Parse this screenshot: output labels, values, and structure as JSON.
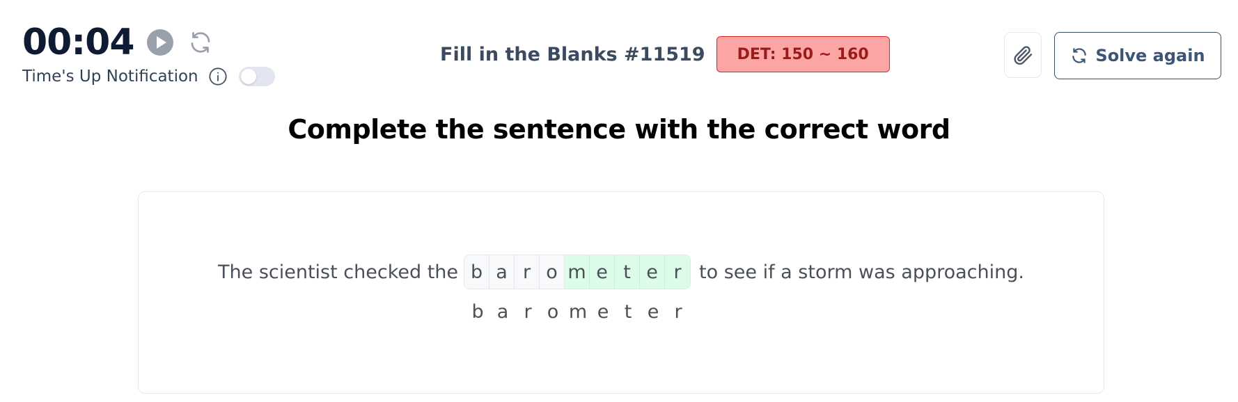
{
  "timer": {
    "time": "00:04",
    "notification_label": "Time's Up Notification",
    "notification_enabled": false
  },
  "header": {
    "quiz_title": "Fill in the Blanks #11519",
    "det_badge": "DET: 150 ~ 160",
    "solve_again_label": "Solve again"
  },
  "heading": "Complete the sentence with the correct word",
  "question": {
    "before": "The scientist checked the",
    "after": "to see if a storm was approaching.",
    "blank_letters": [
      {
        "char": "b",
        "state": "given"
      },
      {
        "char": "a",
        "state": "given"
      },
      {
        "char": "r",
        "state": "given"
      },
      {
        "char": "o",
        "state": "given"
      },
      {
        "char": "m",
        "state": "filled"
      },
      {
        "char": "e",
        "state": "filled"
      },
      {
        "char": "t",
        "state": "filled"
      },
      {
        "char": "e",
        "state": "filled"
      },
      {
        "char": "r",
        "state": "filled"
      }
    ],
    "answer_letters": [
      "b",
      "a",
      "r",
      "o",
      "m",
      "e",
      "t",
      "e",
      "r"
    ]
  },
  "colors": {
    "badge_bg": "#fca5a5",
    "badge_text": "#991b1b",
    "filled_cell": "#dcfce7",
    "given_cell": "#f8f9fa"
  },
  "icons": [
    "play-icon",
    "refresh-icon",
    "info-icon",
    "paperclip-icon",
    "refresh-icon"
  ]
}
